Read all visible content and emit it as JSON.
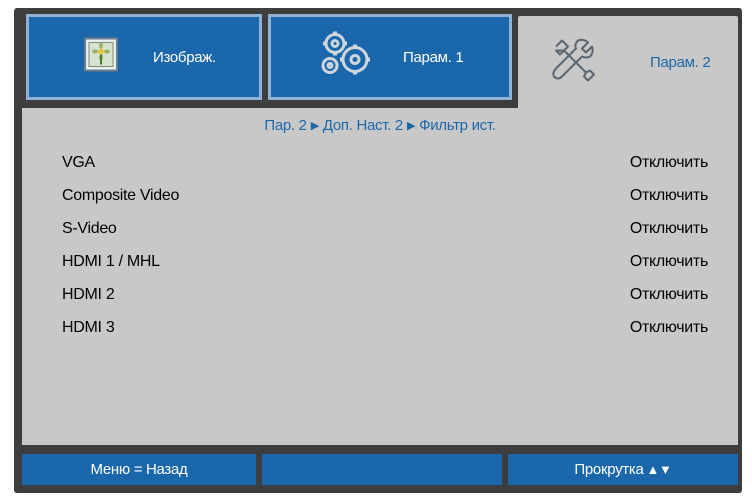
{
  "tabs": [
    {
      "label": "Изображ.",
      "icon": "image-icon",
      "active": false
    },
    {
      "label": "Парам. 1",
      "icon": "gears-icon",
      "active": false
    },
    {
      "label": "Парам. 2",
      "icon": "tools-icon",
      "active": true
    }
  ],
  "breadcrumb": {
    "items": [
      "Пар. 2",
      "Доп. Наст. 2",
      "Фильтр ист."
    ],
    "separator": "▶"
  },
  "rows": [
    {
      "label": "VGA",
      "value": "Отключить"
    },
    {
      "label": "Composite Video",
      "value": "Отключить"
    },
    {
      "label": "S-Video",
      "value": "Отключить"
    },
    {
      "label": "HDMI 1 / MHL",
      "value": "Отключить"
    },
    {
      "label": "HDMI 2",
      "value": "Отключить"
    },
    {
      "label": "HDMI 3",
      "value": "Отключить"
    }
  ],
  "footer": {
    "left": "Меню = Назад",
    "middle": "",
    "right": "Прокрутка",
    "right_arrows": "▲▼"
  },
  "colors": {
    "accent": "#1a67ab",
    "panel": "#c8c8c8",
    "frame": "#3d3d3d"
  }
}
